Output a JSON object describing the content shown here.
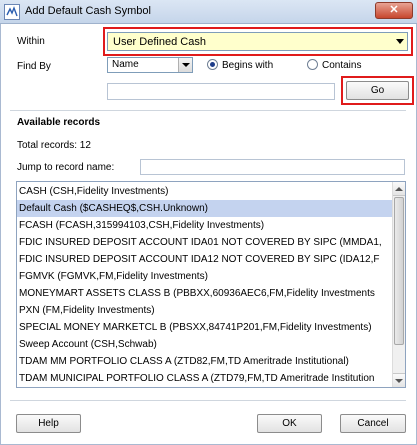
{
  "window": {
    "title": "Add Default Cash Symbol",
    "close_label": "✕"
  },
  "form": {
    "within_label": "Within",
    "within_value": "User Defined Cash",
    "findby_label": "Find By",
    "findby_value": "Name",
    "radio_begins_label": "Begins with",
    "radio_begins_checked": true,
    "radio_contains_label": "Contains",
    "radio_contains_checked": false,
    "search_value": "",
    "go_label": "Go"
  },
  "records": {
    "section_title": "Available records",
    "total_text": "Total records: 12",
    "jump_label": "Jump to record name:",
    "jump_value": "",
    "items": [
      "CASH (CSH,Fidelity Investments)",
      "Default Cash ($CASHEQ$,CSH.Unknown)",
      "FCASH (FCASH,315994103,CSH,Fidelity Investments)",
      "FDIC INSURED DEPOSIT ACCOUNT IDA01 NOT COVERED BY SIPC (MMDA1,",
      "FDIC INSURED DEPOSIT ACCOUNT IDA12 NOT COVERED BY SIPC (IDA12,F",
      "FGMVK (FGMVK,FM,Fidelity Investments)",
      "MONEYMART ASSETS   CLASS B (PBBXX,60936AEC6,FM,Fidelity Investments",
      "PXN (FM,Fidelity Investments)",
      "SPECIAL MONEY MARKETCL B (PBSXX,84741P201,FM,Fidelity Investments)",
      "Sweep Account (CSH,Schwab)",
      "TDAM MM PORTFOLIO CLASS A (ZTD82,FM,TD Ameritrade Institutional)",
      "TDAM MUNICIPAL PORTFOLIO CLASS A (ZTD79,FM,TD Ameritrade Institution"
    ],
    "selected_index": 1
  },
  "buttons": {
    "help": "Help",
    "ok": "OK",
    "cancel": "Cancel"
  },
  "colors": {
    "highlight_border": "#e01b1b",
    "within_bg": "#ffffcc",
    "selection_bg": "#c4d3ef"
  }
}
